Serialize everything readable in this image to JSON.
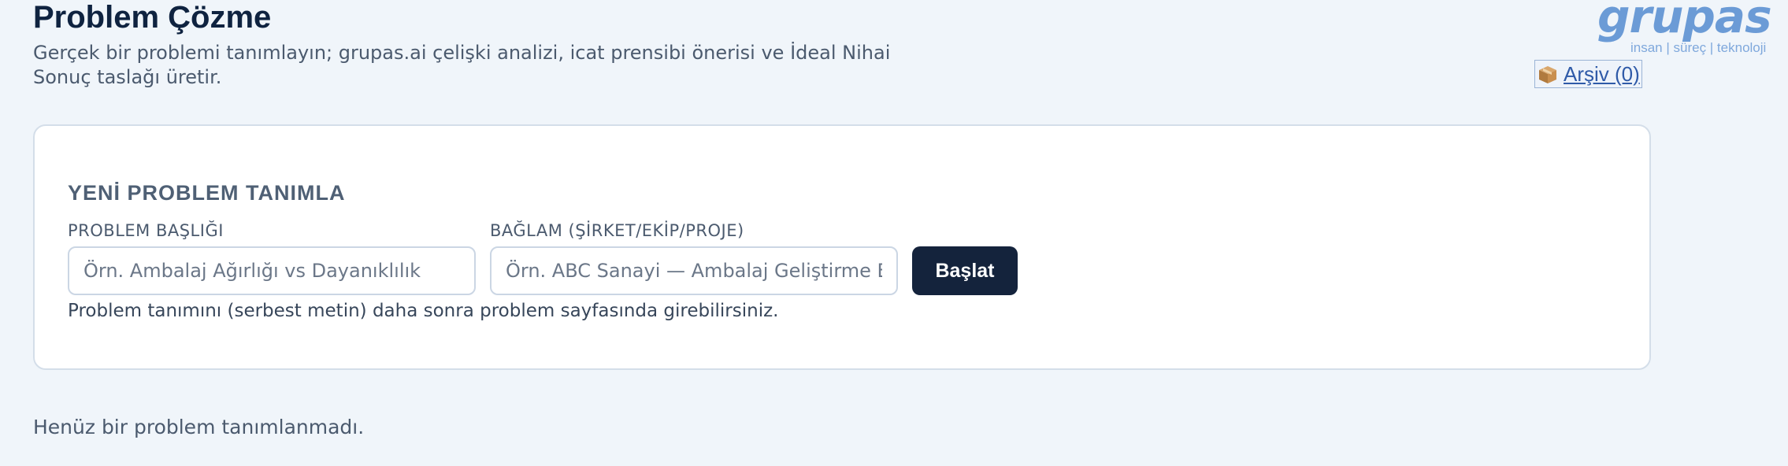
{
  "header": {
    "title": "Problem Çözme",
    "subtitle": "Gerçek bir problemi tanımlayın; grupas.ai çelişki analizi, icat prensibi önerisi ve İdeal Nihai Sonuç taslağı üretir."
  },
  "logo": {
    "wordmark": "grupas",
    "tagline": "insan | süreç | teknoloji",
    "color": "#6b9bd6"
  },
  "archive": {
    "icon": "package-icon",
    "label": "Arşiv (0)"
  },
  "form": {
    "heading": "YENİ PROBLEM TANIMLA",
    "title_label": "PROBLEM BAŞLIĞI",
    "title_placeholder": "Örn. Ambalaj Ağırlığı vs Dayanıklılık",
    "title_value": "",
    "context_label": "BAĞLAM (ŞİRKET/EKİP/PROJE)",
    "context_placeholder": "Örn. ABC Sanayi — Ambalaj Geliştirme Ekibi",
    "context_value": "",
    "submit_label": "Başlat",
    "hint": "Problem tanımını (serbest metin) daha sonra problem sayfasında girebilirsiniz."
  },
  "empty_state": "Henüz bir problem tanımlanmadı.",
  "colors": {
    "background": "#f0f5fa",
    "primary_button": "#14233c",
    "title": "#0f2340",
    "link": "#2f5aa8"
  }
}
